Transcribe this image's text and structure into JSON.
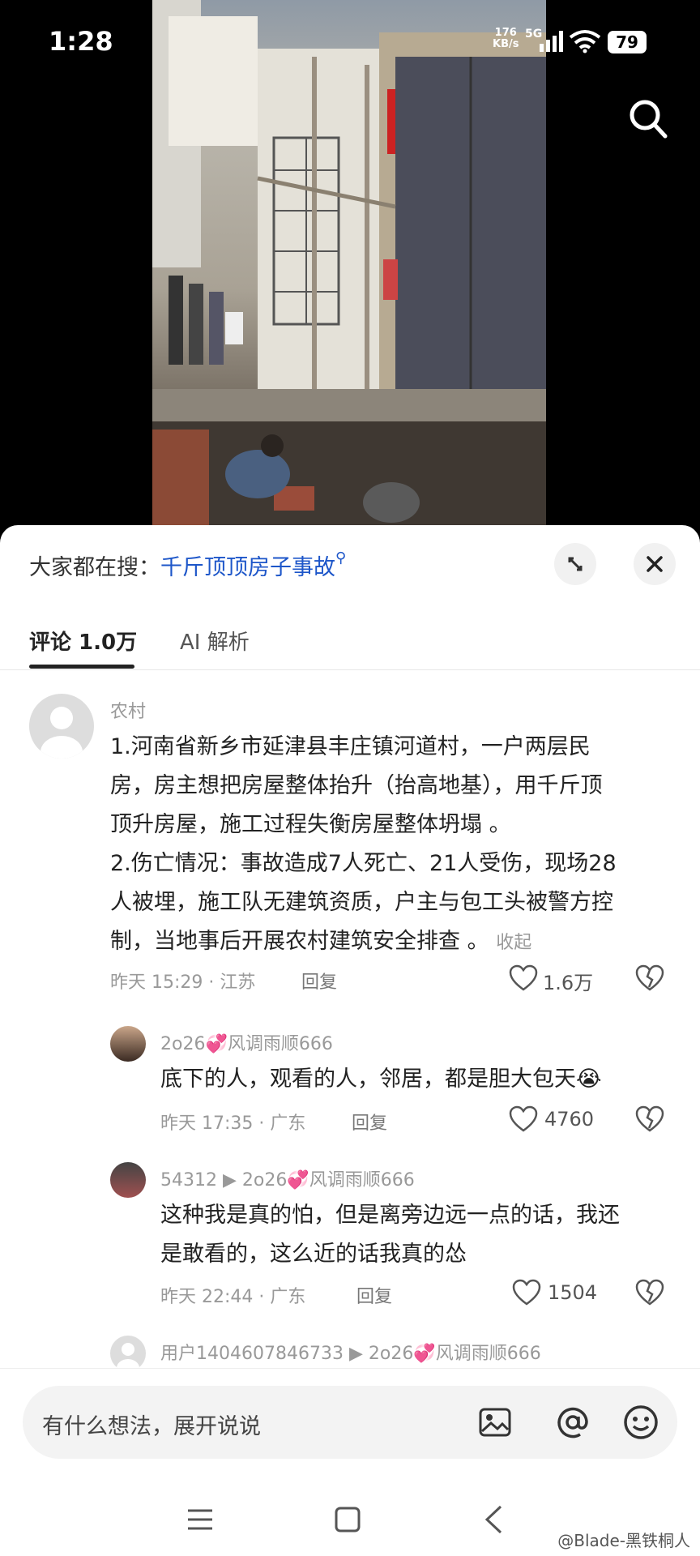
{
  "status_bar": {
    "time": "1:28",
    "net_speed": "176",
    "net_unit": "KB/s",
    "network": "5G",
    "battery": "79"
  },
  "search": {
    "icon": "search-icon"
  },
  "panel": {
    "hot_prefix": "大家都在搜：",
    "hot_query": "千斤顶顶房子事故",
    "expand_icon": "expand-icon",
    "close_icon": "close-icon"
  },
  "tabs": [
    {
      "label": "评论 1.0万",
      "active": true
    },
    {
      "label": "AI 解析",
      "active": false
    }
  ],
  "comments": [
    {
      "user": "农村",
      "lines": [
        "1.河南省新乡市延津县丰庄镇河道村，一户两层民",
        "房，房主想把房屋整体抬升（抬高地基），用千斤顶",
        "顶升房屋，施工过程失衡房屋整体坍塌 。",
        "2.伤亡情况：事故造成7人死亡、21人受伤，现场28",
        "人被埋，施工队无建筑资质，户主与包工头被警方控",
        "制，当地事后开展农村建筑安全排查 。"
      ],
      "collapse": "收起",
      "time": "昨天 15:29 · 江苏",
      "reply": "回复",
      "likes": "1.6万"
    }
  ],
  "replies": [
    {
      "user": "2o26💞风调雨顺666",
      "text": "底下的人，观看的人，邻居，都是胆大包天😭",
      "time": "昨天 17:35 · 广东",
      "reply": "回复",
      "likes": "4760"
    },
    {
      "user": "54312",
      "reply_to": "2o26💞风调雨顺666",
      "lines": [
        "这种我是真的怕，但是离旁边远一点的话，我还",
        "是敢看的，这么近的话我真的怂"
      ],
      "time": "昨天 22:44 · 广东",
      "reply": "回复",
      "likes": "1504"
    },
    {
      "user": "用户1404607846733",
      "reply_to": "2o26💞风调雨顺666"
    }
  ],
  "input": {
    "placeholder": "有什么想法，展开说说"
  },
  "watermark": "@Blade-黑铁桐人",
  "colors": {
    "link": "#1d56c9",
    "text": "#222222",
    "meta": "#999999"
  }
}
